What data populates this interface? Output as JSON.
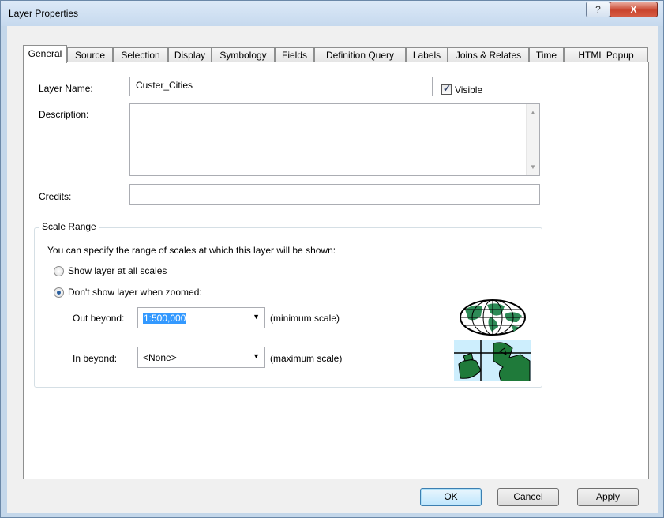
{
  "window": {
    "title": "Layer Properties",
    "help_label": "?",
    "close_label": "X"
  },
  "tabs": [
    {
      "label": "General"
    },
    {
      "label": "Source"
    },
    {
      "label": "Selection"
    },
    {
      "label": "Display"
    },
    {
      "label": "Symbology"
    },
    {
      "label": "Fields"
    },
    {
      "label": "Definition Query"
    },
    {
      "label": "Labels"
    },
    {
      "label": "Joins & Relates"
    },
    {
      "label": "Time"
    },
    {
      "label": "HTML Popup"
    }
  ],
  "general": {
    "layer_name_label": "Layer Name:",
    "layer_name_value": "Custer_Cities",
    "visible_label": "Visible",
    "visible_checked": true,
    "description_label": "Description:",
    "description_value": "",
    "credits_label": "Credits:",
    "credits_value": ""
  },
  "scale_range": {
    "title": "Scale Range",
    "intro": "You can specify the range of scales at which this layer will be shown:",
    "option_all": "Show layer at all scales",
    "option_zoomed": "Don't show layer when zoomed:",
    "selected_option": "zoomed",
    "out_beyond_label": "Out beyond:",
    "out_beyond_value": "1:500,000",
    "out_beyond_hint": "(minimum scale)",
    "in_beyond_label": "In beyond:",
    "in_beyond_value": "<None>",
    "in_beyond_hint": "(maximum scale)",
    "icons": [
      "world-globe-icon",
      "zoomed-map-icon"
    ]
  },
  "buttons": {
    "ok": "OK",
    "cancel": "Cancel",
    "apply": "Apply"
  },
  "colors": {
    "frame": "#c4d7ea",
    "selection": "#3399ff",
    "close_red": "#c9452e"
  }
}
